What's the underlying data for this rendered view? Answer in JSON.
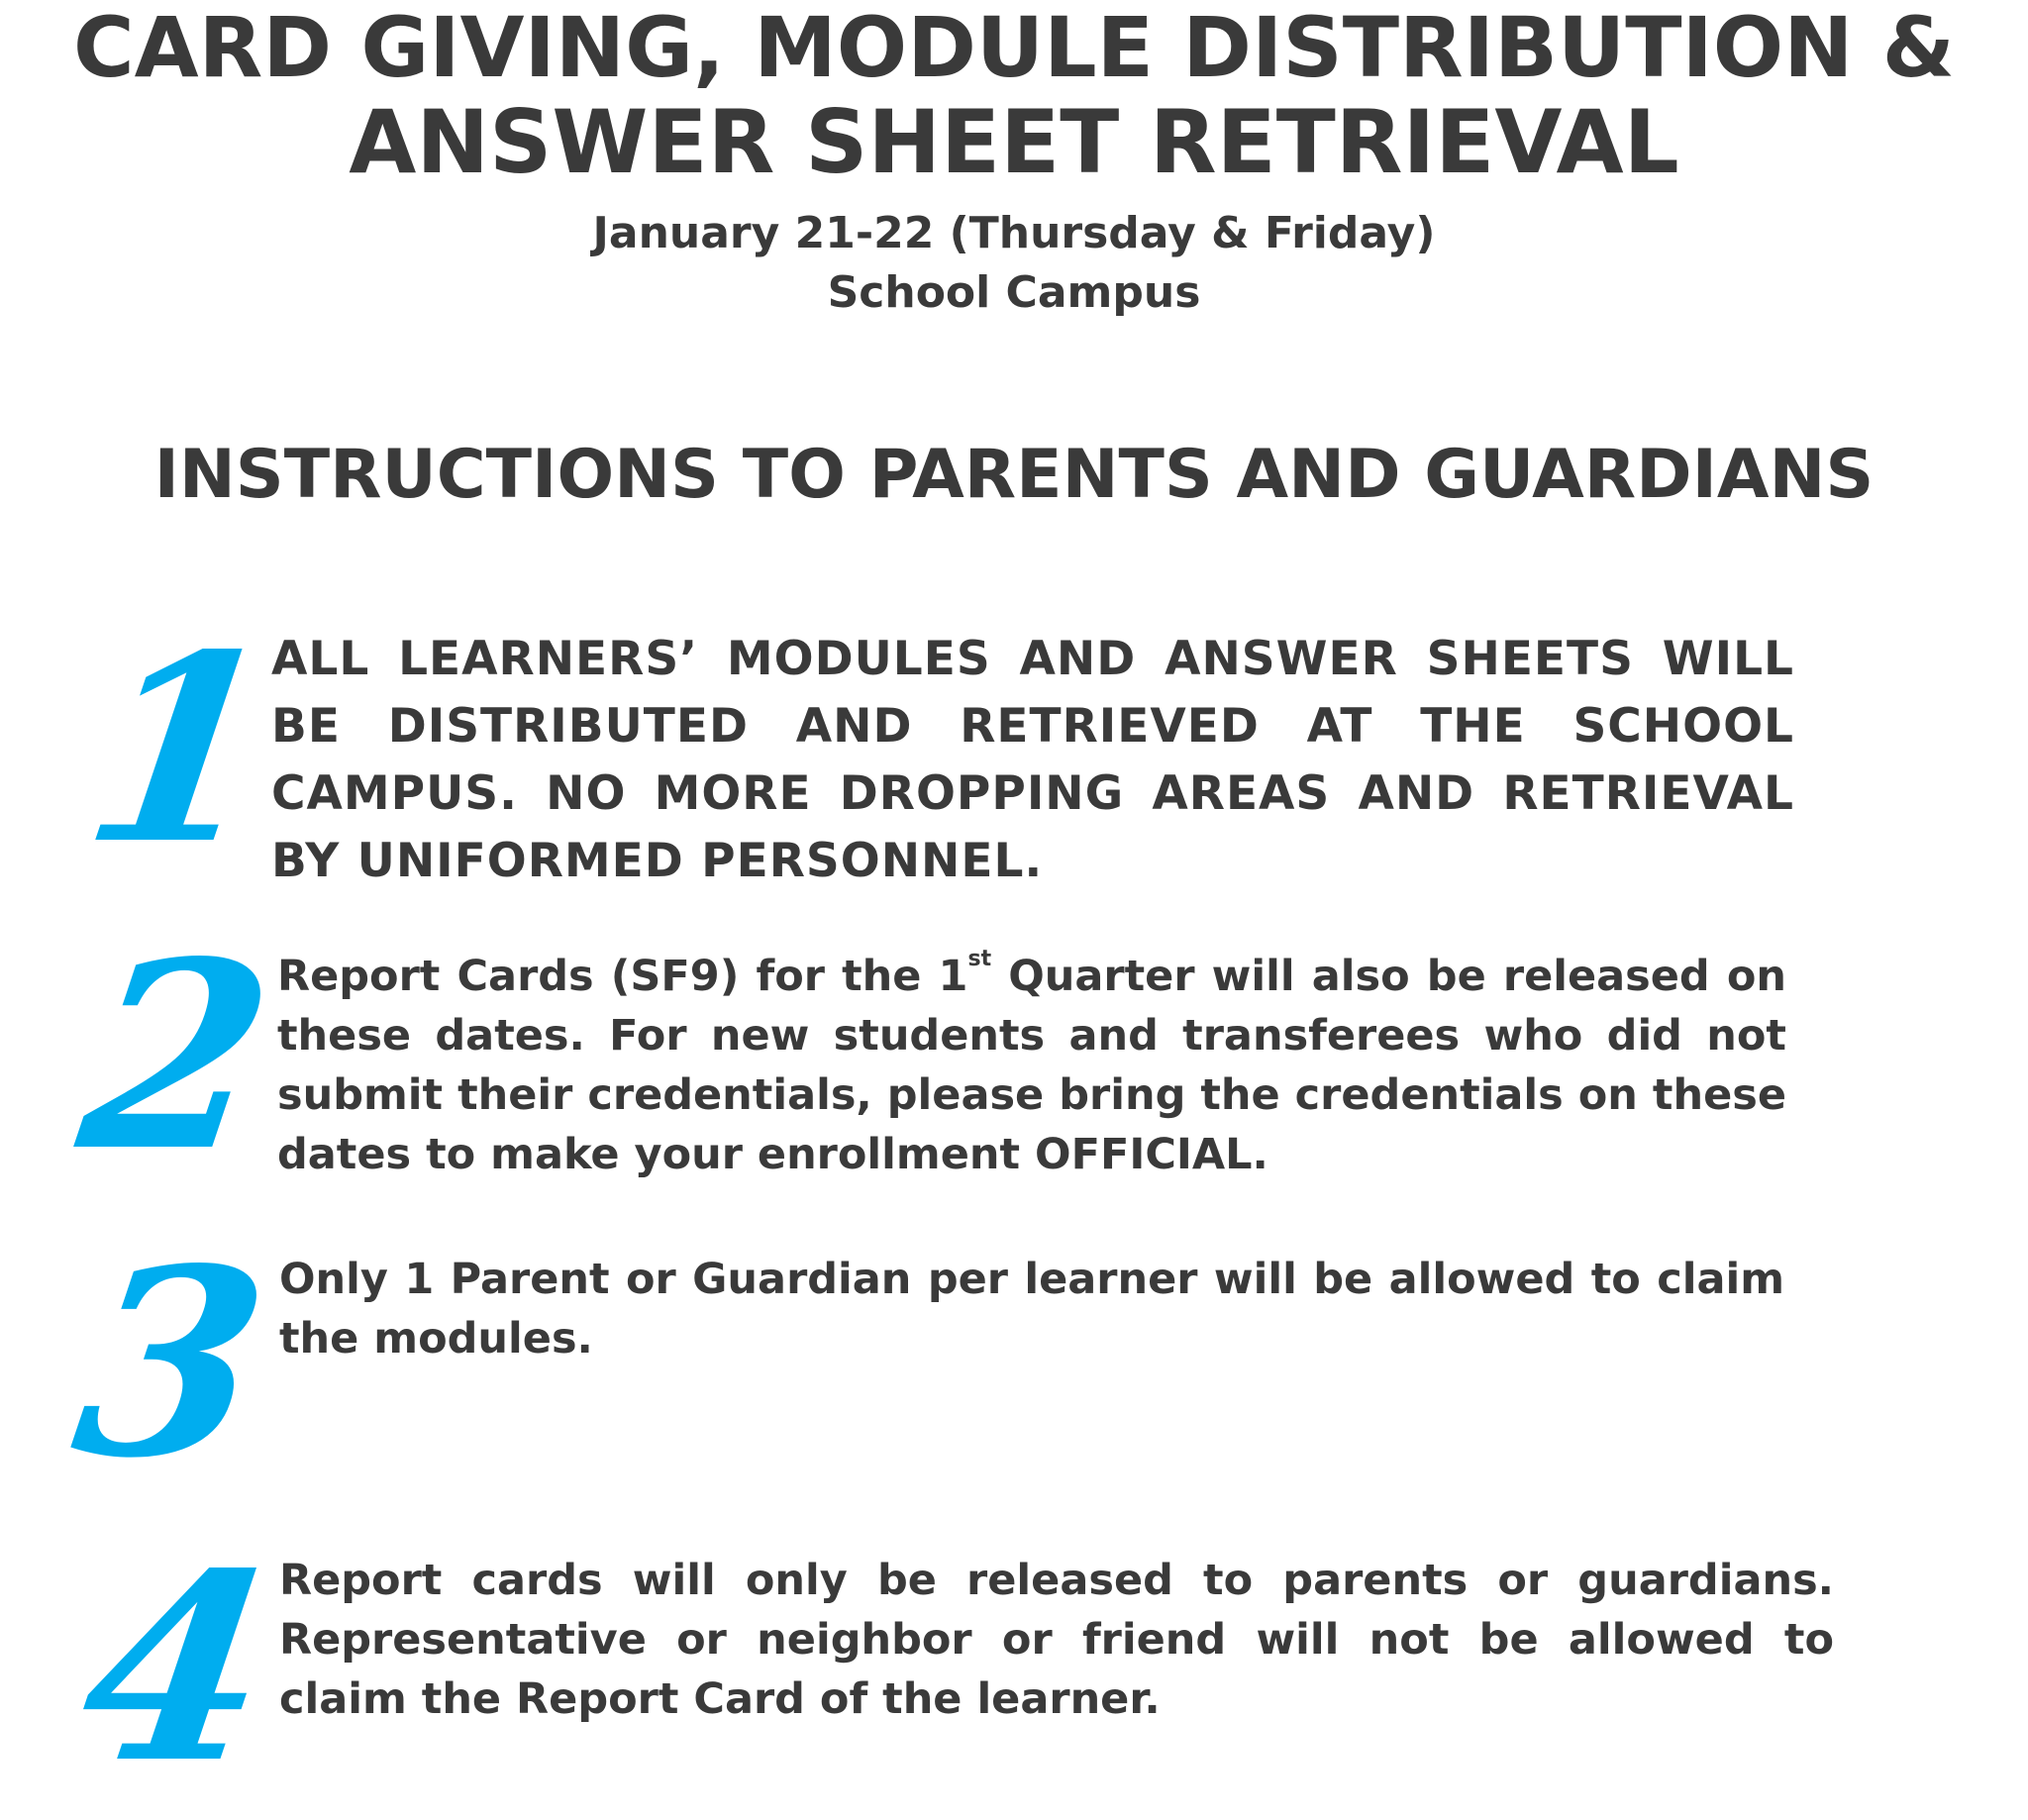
{
  "header": {
    "title_line1": "CARD GIVING, MODULE DISTRIBUTION &",
    "title_line2": "ANSWER SHEET RETRIEVAL",
    "date": "January 21-22 (Thursday & Friday)",
    "location": "School Campus"
  },
  "instructions": {
    "heading": "INSTRUCTIONS TO PARENTS AND GUARDIANS",
    "items": [
      {
        "number": "1",
        "text": "ALL LEARNERS’ MODULES AND ANSWER SHEETS WILL BE DISTRIBUTED AND RETRIEVED AT THE SCHOOL CAMPUS. NO MORE DROPPING AREAS AND RETRIEVAL BY UNIFORMED PERSONNEL."
      },
      {
        "number": "2",
        "text_before": "Report Cards (SF9) for the 1",
        "superscript": "st",
        "text_after": " Quarter will also be released on these dates. For new students and transferees who did not submit their credentials, please bring the credentials on these dates to make your enrollment OFFICIAL."
      },
      {
        "number": "3",
        "text": "Only 1 Parent or Guardian per learner will be allowed to claim the modules."
      },
      {
        "number": "4",
        "text": "Report cards will only be released to parents or guardians. Representative or neighbor or friend will not be allowed to claim the Report Card of the learner."
      }
    ]
  },
  "colors": {
    "number_accent": "#00adef",
    "text": "#3a3a3a"
  }
}
